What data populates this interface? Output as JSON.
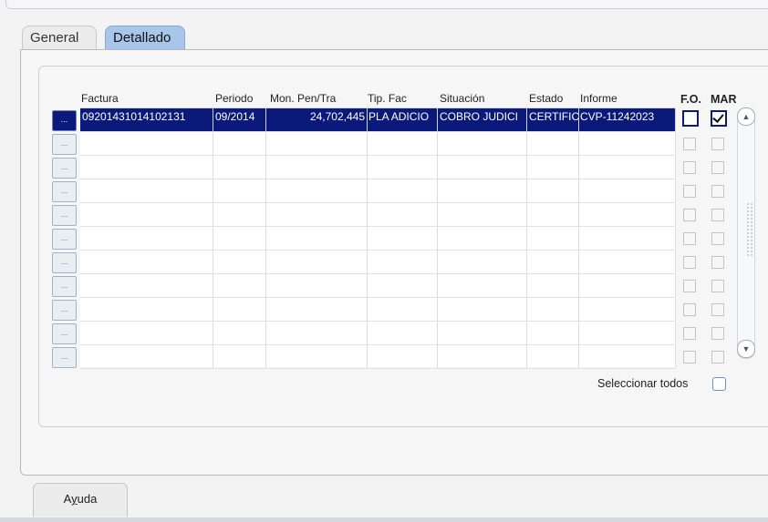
{
  "tabs": [
    {
      "label": "General"
    },
    {
      "label": "Detallado"
    }
  ],
  "columns": [
    "Factura",
    "Periodo",
    "Mon. Pen/Tra",
    "Tip. Fac",
    "Situación",
    "Estado",
    "Informe",
    "F.O.",
    "MAR"
  ],
  "selected_row": {
    "factura": "09201431014102131",
    "periodo": "09/2014",
    "mon_pen_tra": "24,702,445",
    "tip_fac": "PLA ADICIO",
    "situacion": "COBRO JUDICI",
    "estado": "CERTIFIC",
    "informe": "CVP-11242023",
    "fo_checked": false,
    "mar_checked": true
  },
  "row_button_label": "...",
  "empty_rows": 10,
  "select_all_label": "Seleccionar todos",
  "help_button": {
    "prefix": "A",
    "underlined": "y",
    "suffix": "uda"
  },
  "colors": {
    "selected_row": "#0b1a7a",
    "active_tab": "#a7c6ea"
  }
}
